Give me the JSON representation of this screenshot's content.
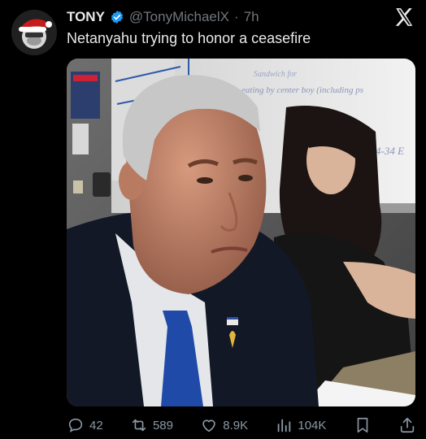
{
  "tweet": {
    "author_name": "TONY",
    "handle": "@TonyMichaelX",
    "separator": "·",
    "time": "7h",
    "text": "Netanyahu trying to honor a ceasefire"
  },
  "media": {
    "whiteboard_line_1": "Sandwich for",
    "whiteboard_line_2": "eating by center boy (including ps",
    "whiteboard_line_3": "4-34 E"
  },
  "actions": {
    "replies": "42",
    "reposts": "589",
    "likes": "8.9K",
    "views": "104K"
  },
  "colors": {
    "background": "#000000",
    "text_primary": "#e7e9ea",
    "text_secondary": "#71767b",
    "verified": "#1d9bf0",
    "action_icons": "#8b98a5"
  },
  "icons": [
    "verified-badge-icon",
    "x-logo-icon",
    "reply-icon",
    "repost-icon",
    "like-icon",
    "views-icon",
    "bookmark-icon",
    "share-icon"
  ]
}
